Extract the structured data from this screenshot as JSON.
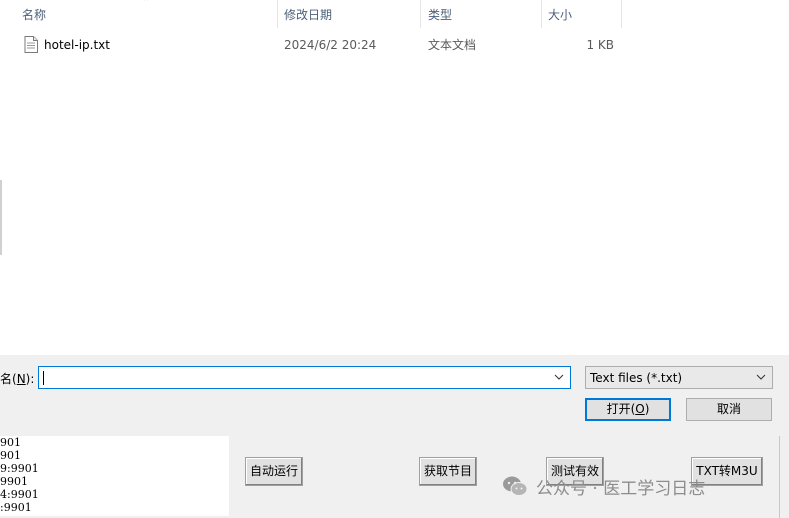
{
  "columns": {
    "name": "名称",
    "modified": "修改日期",
    "type": "类型",
    "size": "大小"
  },
  "file": {
    "name": "hotel-ip.txt",
    "modified": "2024/6/2 20:24",
    "type": "文本文档",
    "size": "1 KB"
  },
  "filename_field": {
    "label_prefix": "名(",
    "label_key": "N",
    "label_suffix": "):",
    "value": ""
  },
  "file_type": {
    "selected": "Text files (*.txt)"
  },
  "buttons": {
    "open_prefix": "打开(",
    "open_key": "O",
    "open_suffix": ")",
    "cancel": "取消"
  },
  "log_lines": [
    "901",
    "901",
    "9:9901",
    "9901",
    "4:9901",
    ":9901"
  ],
  "app_buttons": {
    "auto_run": "自动运行",
    "get_programs": "获取节目",
    "test_valid": "测试有效",
    "txt_to_m3u": "TXT转M3U"
  },
  "watermark": {
    "text": "公众号 · 医工学习日志"
  }
}
